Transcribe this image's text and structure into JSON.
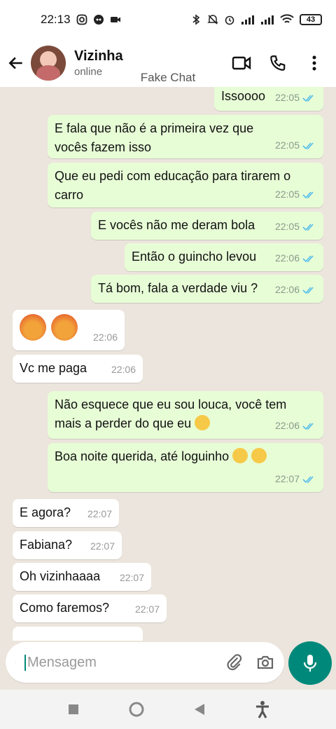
{
  "status_bar": {
    "time": "22:13",
    "battery": "43"
  },
  "header": {
    "contact_name": "Vizinha",
    "contact_status": "online",
    "watermark": "Fake Chat"
  },
  "messages": [
    {
      "dir": "out",
      "text": "Issoooo",
      "time": "22:05"
    },
    {
      "dir": "out",
      "text": "E fala que não é a primeira vez que vocês fazem isso",
      "time": "22:05"
    },
    {
      "dir": "out",
      "text": "Que eu pedi com educação para tirarem o carro",
      "time": "22:05"
    },
    {
      "dir": "out",
      "text": "E vocês não me deram bola",
      "time": "22:05"
    },
    {
      "dir": "out",
      "text": "Então o guincho levou",
      "time": "22:06"
    },
    {
      "dir": "out",
      "text": "Tá bom, fala a verdade viu ?",
      "time": "22:06"
    },
    {
      "dir": "in",
      "text": "",
      "time": "22:06",
      "emoji": [
        "angry-face",
        "angry-face"
      ]
    },
    {
      "dir": "in",
      "text": "Vc me paga",
      "time": "22:06"
    },
    {
      "dir": "out",
      "text": "Não esquece que eu sou louca, você tem mais a perder do que eu",
      "time": "22:06",
      "emoji": [
        "smirking-face"
      ]
    },
    {
      "dir": "out",
      "text": "Boa noite querida, até loguinho",
      "time": "22:07",
      "emoji": [
        "yawning-face",
        "kissing-face"
      ]
    },
    {
      "dir": "in",
      "text": "E agora?",
      "time": "22:07"
    },
    {
      "dir": "in",
      "text": "Fabiana?",
      "time": "22:07"
    },
    {
      "dir": "in",
      "text": "Oh vizinhaaaa",
      "time": "22:07"
    },
    {
      "dir": "in",
      "text": "Como faremos?",
      "time": "22:07"
    }
  ],
  "input": {
    "placeholder": "Mensagem"
  },
  "colors": {
    "accent": "#00897b",
    "outgoing": "#e7fdd6",
    "incoming": "#ffffff",
    "read_ticks": "#53bdeb",
    "background": "#ece5dd"
  }
}
